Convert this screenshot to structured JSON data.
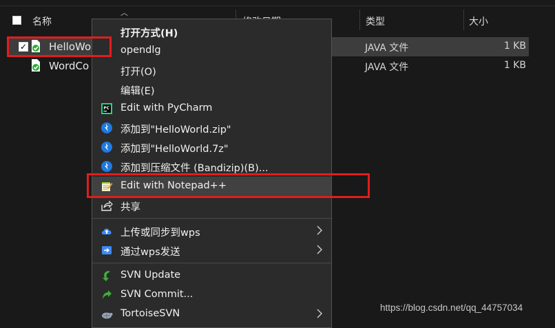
{
  "header": {
    "name_col": "名称",
    "date_col": "修改日期",
    "type_col": "类型",
    "size_col": "大小"
  },
  "files": [
    {
      "name": "HelloWo",
      "type": "JAVA 文件",
      "size": "1 KB",
      "checked": true
    },
    {
      "name": "WordCo",
      "type": "JAVA 文件",
      "size": "1 KB",
      "checked": false
    }
  ],
  "menu": {
    "items": [
      {
        "label": "打开方式(H)",
        "bold": true
      },
      {
        "label": "opendlg"
      },
      {
        "label": "打开(O)"
      },
      {
        "label": "编辑(E)"
      },
      {
        "label": "Edit with PyCharm",
        "icon": "pycharm-icon"
      },
      {
        "label": "添加到\"HelloWorld.zip\"",
        "icon": "bandizip-icon"
      },
      {
        "label": "添加到\"HelloWorld.7z\"",
        "icon": "bandizip-icon"
      },
      {
        "label": "添加到压缩文件 (Bandizip)(B)...",
        "icon": "bandizip-icon"
      },
      {
        "label": "Edit with Notepad++",
        "icon": "notepad-plus-plus-icon"
      },
      {
        "label": "共享",
        "icon": "share-icon"
      },
      {
        "label": "上传或同步到wps",
        "icon": "wps-upload-icon",
        "submenu": true
      },
      {
        "label": "通过wps发送",
        "icon": "wps-send-icon",
        "submenu": true
      },
      {
        "label": "SVN Update",
        "icon": "svn-update-icon"
      },
      {
        "label": "SVN Commit...",
        "icon": "svn-commit-icon"
      },
      {
        "label": "TortoiseSVN",
        "icon": "tortoisesvn-icon",
        "submenu": true
      }
    ]
  },
  "watermark": "https://blog.csdn.net/qq_44757034",
  "colors": {
    "background": "#191919",
    "menu_bg": "#2b2b2b",
    "highlight_red": "#e21d1d",
    "selection": "#3d3d3d"
  }
}
